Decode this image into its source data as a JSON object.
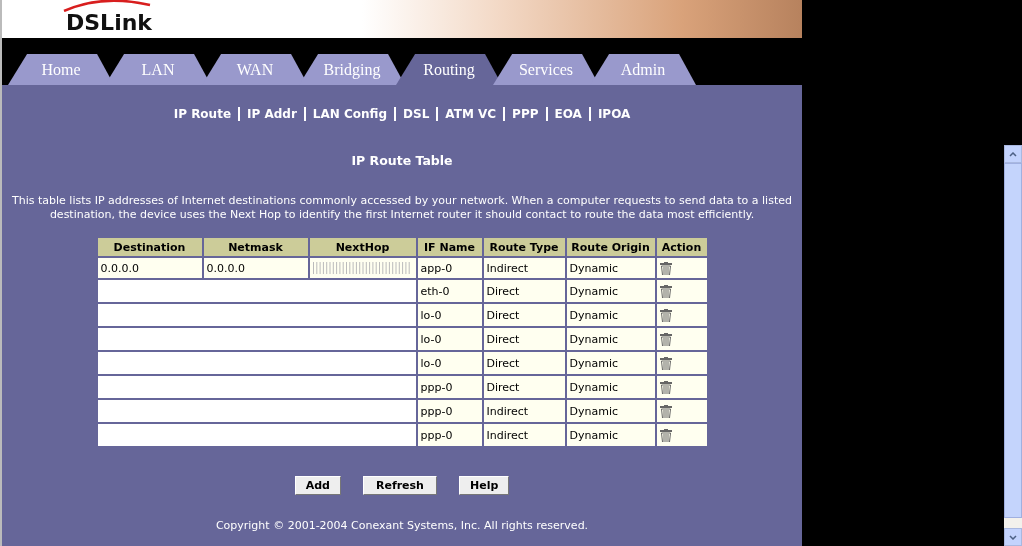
{
  "logo": {
    "text": "DSLink"
  },
  "tabs": [
    {
      "label": "Home",
      "selected": false
    },
    {
      "label": "LAN",
      "selected": false
    },
    {
      "label": "WAN",
      "selected": false
    },
    {
      "label": "Bridging",
      "selected": false
    },
    {
      "label": "Routing",
      "selected": true
    },
    {
      "label": "Services",
      "selected": false
    },
    {
      "label": "Admin",
      "selected": false
    }
  ],
  "subnav": [
    "IP Route",
    "IP Addr",
    "LAN Config",
    "DSL",
    "ATM VC",
    "PPP",
    "EOA",
    "IPOA"
  ],
  "title": "IP Route Table",
  "description": "This table lists IP addresses of Internet destinations commonly accessed by your network. When a computer requests to send data to a listed destination, the device uses the Next Hop to identify the first Internet router it should contact to route the data most efficiently.",
  "table": {
    "columns": [
      "Destination",
      "Netmask",
      "NextHop",
      "IF Name",
      "Route Type",
      "Route Origin",
      "Action"
    ],
    "rows": [
      {
        "destination": "0.0.0.0",
        "netmask": "0.0.0.0",
        "covered": false,
        "if_name": "app-0",
        "route_type": "Indirect",
        "route_origin": "Dynamic"
      },
      {
        "covered": true,
        "if_name": "eth-0",
        "route_type": "Direct",
        "route_origin": "Dynamic"
      },
      {
        "covered": true,
        "if_name": "lo-0",
        "route_type": "Direct",
        "route_origin": "Dynamic"
      },
      {
        "covered": true,
        "if_name": "lo-0",
        "route_type": "Direct",
        "route_origin": "Dynamic"
      },
      {
        "covered": true,
        "if_name": "lo-0",
        "route_type": "Direct",
        "route_origin": "Dynamic"
      },
      {
        "covered": true,
        "if_name": "ppp-0",
        "route_type": "Direct",
        "route_origin": "Dynamic"
      },
      {
        "covered": true,
        "if_name": "ppp-0",
        "route_type": "Indirect",
        "route_origin": "Dynamic"
      },
      {
        "covered": true,
        "if_name": "ppp-0",
        "route_type": "Indirect",
        "route_origin": "Dynamic"
      }
    ]
  },
  "buttons": [
    "Add",
    "Refresh",
    "Help"
  ],
  "copyright": "Copyright © 2001-2004 Conexant Systems, Inc. All rights reserved."
}
